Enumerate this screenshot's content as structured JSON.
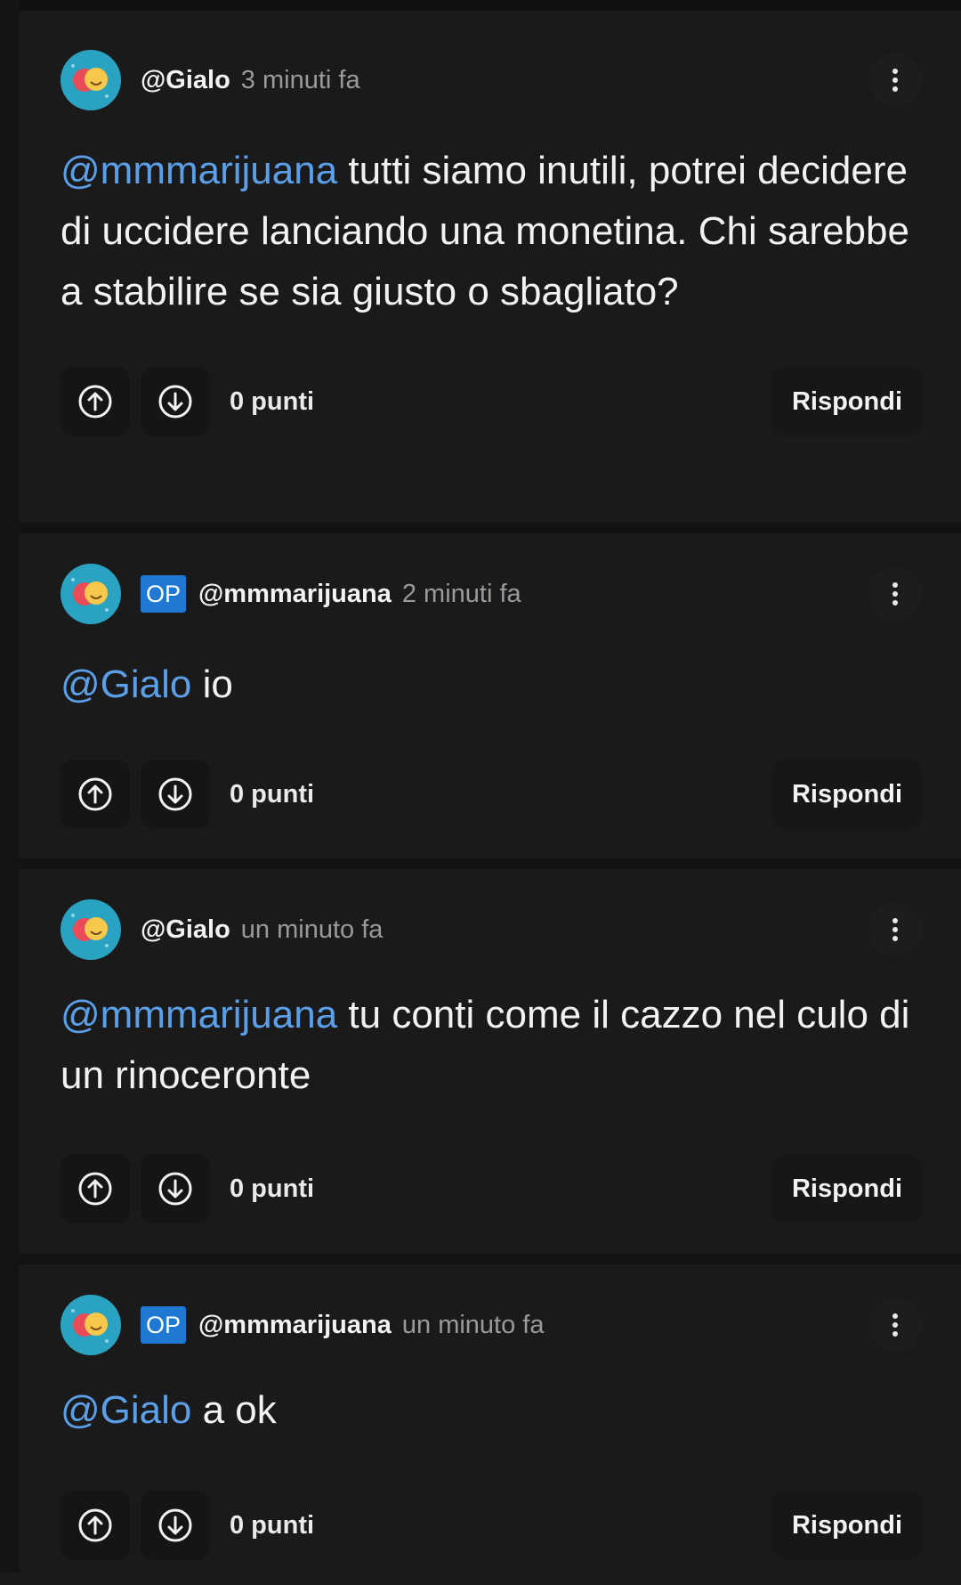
{
  "comments": [
    {
      "username": "@Gialo",
      "op_badge": "",
      "time": "3 minuti fa",
      "mention": "@mmmarijuana",
      "text": " tutti siamo inutili, potrei decidere di uccidere lanciando una monetina. Chi sarebbe a stabilire se sia giusto o sbagliato?",
      "points": "0 punti",
      "reply_label": "Rispondi"
    },
    {
      "username": "@mmmarijuana",
      "op_badge": "OP",
      "time": "2 minuti fa",
      "mention": "@Gialo",
      "text": " io",
      "points": "0 punti",
      "reply_label": "Rispondi"
    },
    {
      "username": "@Gialo",
      "op_badge": "",
      "time": "un minuto fa",
      "mention": "@mmmarijuana",
      "text": " tu conti come il cazzo nel culo di un rinoceronte",
      "points": "0 punti",
      "reply_label": "Rispondi"
    },
    {
      "username": "@mmmarijuana",
      "op_badge": "OP",
      "time": "un minuto fa",
      "mention": "@Gialo",
      "text": " a ok",
      "points": "0 punti",
      "reply_label": "Rispondi"
    }
  ],
  "colors": {
    "background": "#1a1a1b",
    "mention": "#5b9fe8",
    "op_badge": "#1f78d1",
    "avatar": "#2aa3c2"
  },
  "icons": {
    "avatar": "theater-masks-avatar",
    "upvote": "arrow-up-circle-icon",
    "downvote": "arrow-down-circle-icon",
    "more": "more-vertical-icon"
  }
}
